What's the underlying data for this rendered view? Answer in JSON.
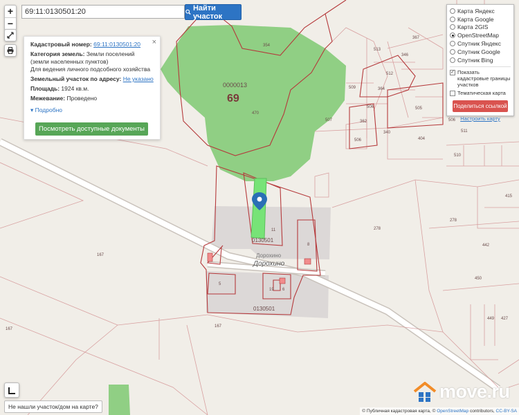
{
  "search": {
    "value": "69:11:0130501:20",
    "button_label": "Найти участок",
    "button_icon": "search-icon"
  },
  "zoom": {
    "in": "+",
    "out": "−"
  },
  "info": {
    "cadastral_label": "Кадастровый номер:",
    "cadastral_number": "69:11:0130501:20",
    "category_label": "Категория земель:",
    "category_value": "Земли поселений (земли населенных пунктов)",
    "usage": "Для ведения личного подсобного хозяйства",
    "address_label": "Земельный участок по адресу:",
    "address_value": "Не указано",
    "area_label": "Площадь:",
    "area_value": "1924 кв.м.",
    "survey_label": "Межевание:",
    "survey_value": "Проведено",
    "more": "Подробно",
    "docs_button": "Посмотреть доступные документы",
    "close": "×"
  },
  "layers": {
    "options": [
      "Карта Яндекс",
      "Карта Google",
      "Карта 2GIS",
      "OpenStreetMap",
      "Спутник Яндекс",
      "Спутник Google",
      "Спутник Bing"
    ],
    "selected": "OpenStreetMap",
    "checkbox_cadastral": "Показать кадастровые границы участков",
    "checkbox_thematic": "Тематическая карта",
    "share_button": "Поделиться ссылкой",
    "setup_link": "Настроить карту"
  },
  "map": {
    "labels": {
      "quarter_top": "0000013",
      "region_69": "69",
      "n470": "470",
      "n354": "354",
      "quarter_mid": "0130501",
      "dorokhino_small": "Дорохино",
      "dorokhino_big": "Дорохино",
      "quarter_bottom": "0130501",
      "n11": "11",
      "n8": "8",
      "n5": "5",
      "n19": "19",
      "n6": "6",
      "n167a": "167",
      "n167b": "167",
      "n167c": "167",
      "n278a": "278",
      "n278b": "278",
      "n367": "367",
      "n513": "513",
      "n346": "346",
      "n512": "512",
      "n364": "364",
      "n509": "509",
      "n506": "506",
      "n362": "362",
      "n507": "507",
      "n505": "505",
      "n340": "340",
      "n506b": "506",
      "n404": "404",
      "n506c": "506",
      "n511": "511",
      "n510": "510",
      "n415": "415",
      "n442": "442",
      "n450": "450",
      "n449": "449",
      "n427": "427"
    }
  },
  "not_found": "Не нашли участок/дом на карте?",
  "attribution": {
    "prefix": "© Публичная кадастровая карта, © ",
    "osm": "OpenStreetMap",
    "mid": " contributors, ",
    "license": "CC-BY-SA"
  },
  "watermark": "move.ru",
  "colors": {
    "forest": "#8fcf85",
    "boundary": "#b5393b",
    "selected_parcel": "#77e377",
    "pin": "#2a6fb5",
    "button_blue": "#2d74c4",
    "button_green": "#57a657",
    "button_red": "#d9534f"
  }
}
